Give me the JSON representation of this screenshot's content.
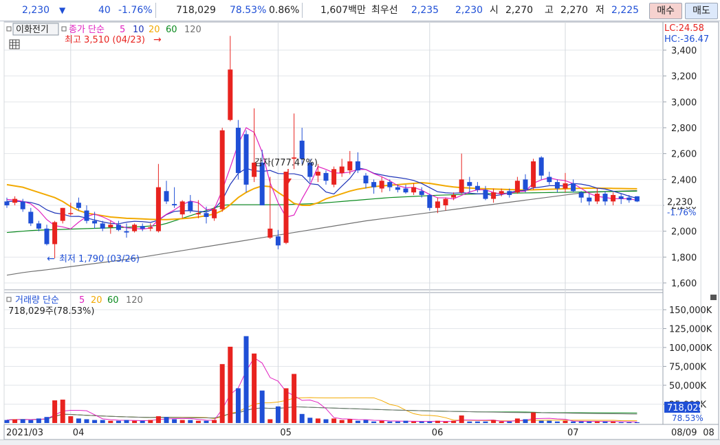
{
  "quote": {
    "price": "2,230",
    "direction_icon": "down-triangle-icon",
    "change": "40",
    "change_pct": "-1.76%",
    "volume": "718,029",
    "vol_ratio": "78.53%",
    "turnover_pct": "0.86%",
    "amount": "1,607백만",
    "best_label": "최우선",
    "best_ask": "2,235",
    "best_bid": "2,230",
    "open_label": "시",
    "open": "2,270",
    "high_label": "고",
    "high": "2,270",
    "low_label": "저",
    "low": "2,225",
    "buy_label": "매수",
    "sell_label": "매도"
  },
  "colors": {
    "up": "#e8231f",
    "down": "#1f4fd6",
    "ma5": "#e020c0",
    "ma10": "#1c32b8",
    "ma20": "#f2a900",
    "ma60": "#0a8a1e",
    "ma120": "#707070"
  },
  "price_panel": {
    "toggle_label": "이화전기",
    "legend_prefix": "종가 단순",
    "legend": [
      "5",
      "10",
      "20",
      "60",
      "120"
    ],
    "lc": "LC:24.58",
    "hc": "HC:-36.47",
    "y_ticks": [
      "3,400",
      "3,200",
      "3,000",
      "2,800",
      "2,600",
      "2,400",
      "2,200",
      "2,000",
      "1,800",
      "1,600"
    ],
    "last_label": "2,230",
    "last_pct": "-1.76%",
    "high_note": "최고 3,510 (04/23)",
    "low_note": "최저 1,790 (03/26)",
    "event_note": "감자(777.47%)"
  },
  "volume_panel": {
    "legend_prefix": "거래량 단순",
    "legend": [
      "5",
      "20",
      "60",
      "120"
    ],
    "info": "718,029주(78.53%)",
    "y_ticks": [
      "150,000K",
      "125,000K",
      "100,000K",
      "75,000K",
      "50,000K",
      "25,000K"
    ],
    "last_label": "718,029",
    "last_pct": "78.53%"
  },
  "x_axis": {
    "labels": [
      "2021/03",
      "04",
      "05",
      "06",
      "07",
      "08"
    ],
    "end_label": "08/09"
  },
  "chart_data": {
    "type": "candlestick",
    "y_range": [
      1600,
      3400
    ],
    "volume_range_k": [
      0,
      150000
    ],
    "candles": [
      {
        "o": 2230,
        "h": 2260,
        "l": 2180,
        "c": 2200
      },
      {
        "o": 2220,
        "h": 2270,
        "l": 2200,
        "c": 2250
      },
      {
        "o": 2230,
        "h": 2250,
        "l": 2150,
        "c": 2170
      },
      {
        "o": 2150,
        "h": 2180,
        "l": 2040,
        "c": 2060
      },
      {
        "o": 2060,
        "h": 2080,
        "l": 2000,
        "c": 2020
      },
      {
        "o": 2020,
        "h": 2050,
        "l": 1890,
        "c": 1900
      },
      {
        "o": 1900,
        "h": 2080,
        "l": 1790,
        "c": 2070
      },
      {
        "o": 2080,
        "h": 2180,
        "l": 2060,
        "c": 2180
      },
      {
        "o": 2140,
        "h": 2220,
        "l": 2120,
        "c": 2140
      },
      {
        "o": 2220,
        "h": 2260,
        "l": 2160,
        "c": 2180
      },
      {
        "o": 2160,
        "h": 2200,
        "l": 2060,
        "c": 2080
      },
      {
        "o": 2080,
        "h": 2150,
        "l": 2020,
        "c": 2060
      },
      {
        "o": 2060,
        "h": 2080,
        "l": 2000,
        "c": 2020
      },
      {
        "o": 2030,
        "h": 2080,
        "l": 1980,
        "c": 2050
      },
      {
        "o": 2050,
        "h": 2080,
        "l": 2000,
        "c": 2010
      },
      {
        "o": 2000,
        "h": 2060,
        "l": 1950,
        "c": 1990
      },
      {
        "o": 2000,
        "h": 2060,
        "l": 1990,
        "c": 2050
      },
      {
        "o": 2040,
        "h": 2060,
        "l": 2000,
        "c": 2020
      },
      {
        "o": 2020,
        "h": 2060,
        "l": 2000,
        "c": 2030
      },
      {
        "o": 2000,
        "h": 2520,
        "l": 1990,
        "c": 2340
      },
      {
        "o": 2310,
        "h": 2390,
        "l": 2210,
        "c": 2230
      },
      {
        "o": 2210,
        "h": 2340,
        "l": 2180,
        "c": 2200
      },
      {
        "o": 2130,
        "h": 2240,
        "l": 2100,
        "c": 2230
      },
      {
        "o": 2230,
        "h": 2280,
        "l": 2140,
        "c": 2160
      },
      {
        "o": 2130,
        "h": 2240,
        "l": 2100,
        "c": 2140
      },
      {
        "o": 2140,
        "h": 2190,
        "l": 2060,
        "c": 2110
      },
      {
        "o": 2100,
        "h": 2190,
        "l": 2080,
        "c": 2170
      },
      {
        "o": 2170,
        "h": 2800,
        "l": 2150,
        "c": 2780
      },
      {
        "o": 2860,
        "h": 3510,
        "l": 2850,
        "c": 3250
      },
      {
        "o": 2800,
        "h": 2860,
        "l": 2400,
        "c": 2450
      },
      {
        "o": 2750,
        "h": 2780,
        "l": 2300,
        "c": 2360
      },
      {
        "o": 2420,
        "h": 2950,
        "l": 2380,
        "c": 2530
      },
      {
        "o": 2530,
        "h": 2630,
        "l": 2320,
        "c": 2200
      },
      {
        "o": 1950,
        "h": 2420,
        "l": 1940,
        "c": 2020
      },
      {
        "o": 1960,
        "h": 2010,
        "l": 1860,
        "c": 1890
      },
      {
        "o": 1910,
        "h": 2450,
        "l": 1900,
        "c": 2460
      },
      {
        "o": 2560,
        "h": 2910,
        "l": 2480,
        "c": 2570
      },
      {
        "o": 2700,
        "h": 2800,
        "l": 2520,
        "c": 2560
      },
      {
        "o": 2530,
        "h": 2560,
        "l": 2380,
        "c": 2420
      },
      {
        "o": 2430,
        "h": 2520,
        "l": 2380,
        "c": 2460
      },
      {
        "o": 2450,
        "h": 2470,
        "l": 2360,
        "c": 2390
      },
      {
        "o": 2360,
        "h": 2500,
        "l": 2340,
        "c": 2480
      },
      {
        "o": 2450,
        "h": 2560,
        "l": 2420,
        "c": 2500
      },
      {
        "o": 2470,
        "h": 2620,
        "l": 2440,
        "c": 2540
      },
      {
        "o": 2540,
        "h": 2610,
        "l": 2450,
        "c": 2470
      },
      {
        "o": 2430,
        "h": 2450,
        "l": 2330,
        "c": 2370
      },
      {
        "o": 2380,
        "h": 2400,
        "l": 2290,
        "c": 2340
      },
      {
        "o": 2330,
        "h": 2420,
        "l": 2300,
        "c": 2390
      },
      {
        "o": 2380,
        "h": 2400,
        "l": 2310,
        "c": 2340
      },
      {
        "o": 2340,
        "h": 2360,
        "l": 2300,
        "c": 2320
      },
      {
        "o": 2330,
        "h": 2360,
        "l": 2290,
        "c": 2300
      },
      {
        "o": 2300,
        "h": 2370,
        "l": 2280,
        "c": 2340
      },
      {
        "o": 2310,
        "h": 2340,
        "l": 2260,
        "c": 2280
      },
      {
        "o": 2280,
        "h": 2290,
        "l": 2160,
        "c": 2180
      },
      {
        "o": 2180,
        "h": 2260,
        "l": 2140,
        "c": 2230
      },
      {
        "o": 2200,
        "h": 2260,
        "l": 2160,
        "c": 2250
      },
      {
        "o": 2260,
        "h": 2300,
        "l": 2240,
        "c": 2280
      },
      {
        "o": 2300,
        "h": 2600,
        "l": 2290,
        "c": 2400
      },
      {
        "o": 2380,
        "h": 2420,
        "l": 2300,
        "c": 2350
      },
      {
        "o": 2350,
        "h": 2380,
        "l": 2300,
        "c": 2320
      },
      {
        "o": 2320,
        "h": 2350,
        "l": 2240,
        "c": 2250
      },
      {
        "o": 2250,
        "h": 2330,
        "l": 2220,
        "c": 2300
      },
      {
        "o": 2290,
        "h": 2330,
        "l": 2270,
        "c": 2310
      },
      {
        "o": 2310,
        "h": 2330,
        "l": 2260,
        "c": 2280
      },
      {
        "o": 2300,
        "h": 2420,
        "l": 2290,
        "c": 2390
      },
      {
        "o": 2400,
        "h": 2440,
        "l": 2300,
        "c": 2320
      },
      {
        "o": 2340,
        "h": 2560,
        "l": 2320,
        "c": 2540
      },
      {
        "o": 2570,
        "h": 2580,
        "l": 2400,
        "c": 2430
      },
      {
        "o": 2420,
        "h": 2460,
        "l": 2360,
        "c": 2380
      },
      {
        "o": 2380,
        "h": 2400,
        "l": 2300,
        "c": 2330
      },
      {
        "o": 2330,
        "h": 2450,
        "l": 2300,
        "c": 2370
      },
      {
        "o": 2370,
        "h": 2400,
        "l": 2300,
        "c": 2310
      },
      {
        "o": 2300,
        "h": 2310,
        "l": 2220,
        "c": 2260
      },
      {
        "o": 2260,
        "h": 2290,
        "l": 2200,
        "c": 2230
      },
      {
        "o": 2230,
        "h": 2330,
        "l": 2210,
        "c": 2290
      },
      {
        "o": 2290,
        "h": 2310,
        "l": 2200,
        "c": 2230
      },
      {
        "o": 2230,
        "h": 2300,
        "l": 2200,
        "c": 2280
      },
      {
        "o": 2270,
        "h": 2290,
        "l": 2210,
        "c": 2250
      },
      {
        "o": 2260,
        "h": 2280,
        "l": 2220,
        "c": 2240
      },
      {
        "o": 2270,
        "h": 2270,
        "l": 2225,
        "c": 2230
      }
    ],
    "volume_k": [
      4,
      5,
      5,
      4,
      6,
      8,
      30,
      31,
      9,
      6,
      5,
      4,
      4,
      3,
      3,
      4,
      3,
      3,
      4,
      9,
      8,
      5,
      4,
      4,
      3,
      3,
      4,
      78,
      101,
      46,
      115,
      92,
      43,
      5,
      22,
      46,
      65,
      12,
      7,
      6,
      5,
      6,
      4,
      5,
      3,
      4,
      2,
      3,
      2,
      2,
      3,
      2,
      2,
      2,
      3,
      2,
      3,
      10,
      2,
      2,
      2,
      4,
      2,
      2,
      6,
      5,
      14,
      3,
      3,
      2,
      3,
      2,
      2,
      2,
      2,
      2,
      2,
      1,
      1,
      1
    ],
    "ma": {
      "5": [
        2245,
        2241,
        2231,
        2211,
        2160,
        2090,
        2043,
        2033,
        2018,
        2070,
        2114,
        2132,
        2111,
        2082,
        2044,
        2026,
        2021,
        2016,
        2025,
        2088,
        2131,
        2165,
        2206,
        2233,
        2220,
        2166,
        2172,
        2317,
        2492,
        2674,
        2800,
        2764,
        2611,
        2375,
        2220,
        2108,
        2125,
        2250,
        2359,
        2500,
        2478,
        2451,
        2449,
        2457,
        2478,
        2477,
        2445,
        2421,
        2390,
        2352,
        2336,
        2339,
        2317,
        2284,
        2258,
        2258,
        2250,
        2277,
        2304,
        2320,
        2320,
        2299,
        2287,
        2292,
        2307,
        2309,
        2371,
        2397,
        2413,
        2398,
        2391,
        2368,
        2331,
        2292,
        2269,
        2261,
        2251,
        2251,
        2251,
        2239
      ],
      "10": [
        2230,
        2232,
        2229,
        2222,
        2205,
        2165,
        2141,
        2132,
        2114,
        2115,
        2102,
        2087,
        2072,
        2060,
        2057,
        2070,
        2077,
        2074,
        2068,
        2085,
        2128,
        2153,
        2158,
        2158,
        2153,
        2149,
        2171,
        2241,
        2362,
        2447,
        2486,
        2467,
        2462,
        2470,
        2446,
        2444,
        2444,
        2430,
        2367,
        2360,
        2303,
        2288,
        2349,
        2408,
        2489,
        2477,
        2448,
        2435,
        2423,
        2415,
        2406,
        2392,
        2369,
        2337,
        2305,
        2297,
        2294,
        2297,
        2294,
        2289,
        2289,
        2274,
        2282,
        2298,
        2313,
        2314,
        2335,
        2342,
        2352,
        2352,
        2350,
        2369,
        2364,
        2352,
        2333,
        2326,
        2309,
        2291,
        2271,
        2254
      ],
      "20": [
        2360,
        2350,
        2340,
        2320,
        2300,
        2280,
        2260,
        2230,
        2190,
        2160,
        2140,
        2130,
        2120,
        2110,
        2105,
        2100,
        2098,
        2095,
        2092,
        2090,
        2090,
        2093,
        2097,
        2102,
        2110,
        2120,
        2133,
        2160,
        2205,
        2260,
        2300,
        2330,
        2350,
        2345,
        2300,
        2260,
        2215,
        2200,
        2200,
        2220,
        2250,
        2270,
        2290,
        2310,
        2325,
        2335,
        2345,
        2350,
        2355,
        2360,
        2365,
        2370,
        2375,
        2370,
        2360,
        2350,
        2342,
        2337,
        2334,
        2330,
        2328,
        2326,
        2324,
        2322,
        2320,
        2318,
        2320,
        2322,
        2324,
        2326,
        2328,
        2330,
        2332,
        2333,
        2333,
        2332,
        2331,
        2330,
        2329,
        2328
      ],
      "60": [
        1990,
        1995,
        2000,
        2005,
        2008,
        2010,
        2012,
        2014,
        2016,
        2018,
        2020,
        2022,
        2024,
        2026,
        2028,
        2030,
        2033,
        2036,
        2040,
        2045,
        2060,
        2080,
        2100,
        2120,
        2140,
        2160,
        2180,
        2200,
        2205,
        2205,
        2205,
        2205,
        2205,
        2205,
        2205,
        2205,
        2208,
        2210,
        2212,
        2215,
        2220,
        2225,
        2230,
        2235,
        2240,
        2245,
        2250,
        2255,
        2260,
        2263,
        2266,
        2269,
        2272,
        2275,
        2278,
        2280,
        2282,
        2284,
        2286,
        2288,
        2290,
        2292,
        2293,
        2294,
        2295,
        2296,
        2297,
        2298,
        2299,
        2300,
        2301,
        2302,
        2303,
        2304,
        2305,
        2306,
        2307,
        2308,
        2309,
        2310
      ],
      "120": [
        1660,
        1670,
        1680,
        1688,
        1695,
        1702,
        1710,
        1718,
        1726,
        1734,
        1742,
        1750,
        1758,
        1766,
        1774,
        1782,
        1790,
        1800,
        1810,
        1820,
        1830,
        1840,
        1850,
        1860,
        1870,
        1880,
        1890,
        1900,
        1910,
        1920,
        1930,
        1940,
        1950,
        1960,
        1970,
        1980,
        1990,
        2000,
        2010,
        2020,
        2030,
        2040,
        2050,
        2060,
        2070,
        2080,
        2088,
        2096,
        2104,
        2112,
        2120,
        2128,
        2136,
        2144,
        2152,
        2160,
        2168,
        2176,
        2184,
        2192,
        2200,
        2208,
        2216,
        2224,
        2232,
        2240,
        2248,
        2256,
        2264,
        2272,
        2280,
        2288,
        2295,
        2300,
        2303,
        2306,
        2308,
        2310,
        2312,
        2314
      ]
    }
  }
}
